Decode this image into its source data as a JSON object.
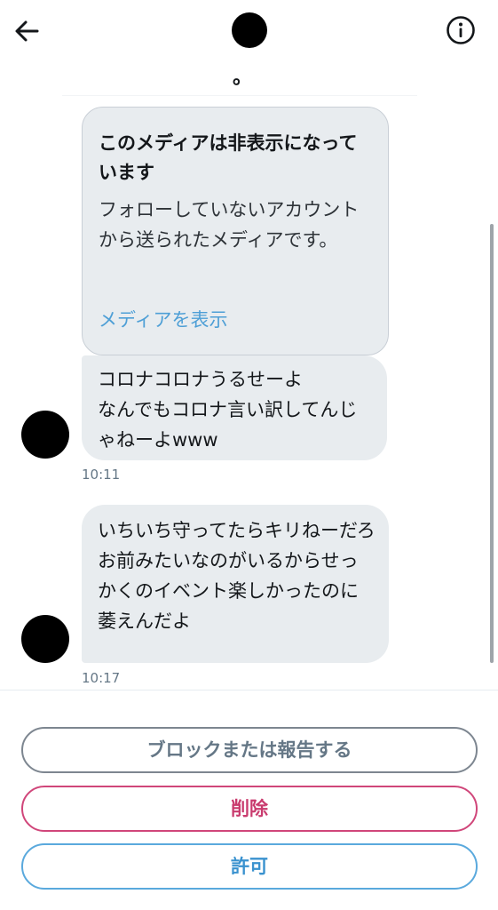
{
  "header": {
    "name": "。",
    "back_icon": "arrow-left-icon",
    "info_icon": "info-circle-icon"
  },
  "media_notice": {
    "title": "このメディアは非表示になっています",
    "description": "フォローしていないアカウントから送られたメディアです。",
    "link": "メディアを表示"
  },
  "messages": [
    {
      "text": "コロナコロナうるせーよ\nなんでもコロナ言い訳してんじゃねーよwww",
      "time": "10:11"
    },
    {
      "text": "いちいち守ってたらキリねーだろ\nお前みたいなのがいるからせっかくのイベント楽しかったのに萎えんだよ",
      "time": "10:17"
    }
  ],
  "actions": {
    "block_report": "ブロックまたは報告する",
    "delete": "削除",
    "allow": "許可"
  },
  "colors": {
    "bubble": "#e8ecef",
    "link": "#4e9fd6",
    "delete": "#c93b6e",
    "allow": "#3a92cf",
    "neutral": "#657786"
  }
}
